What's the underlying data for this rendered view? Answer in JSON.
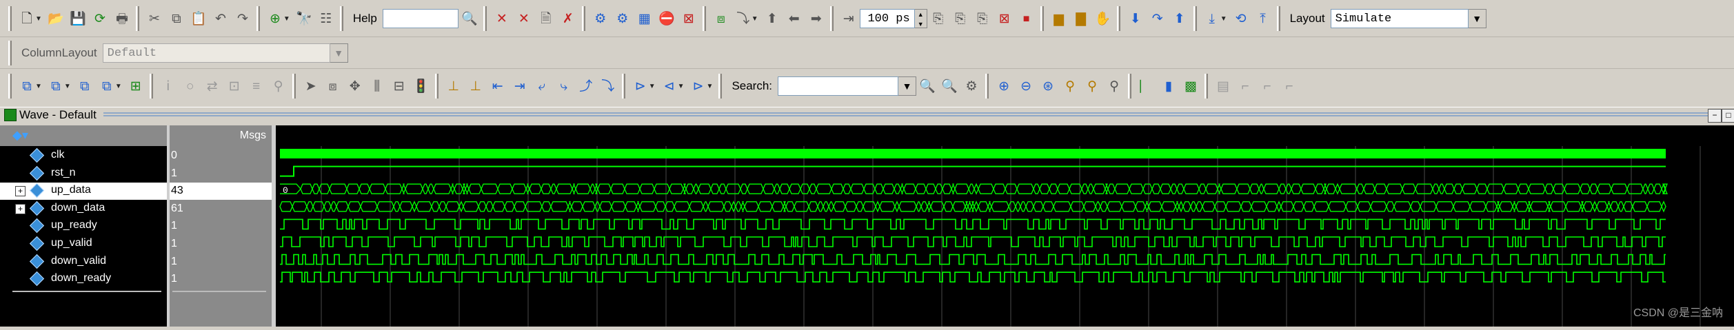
{
  "toolbar": {
    "help_label": "Help",
    "help_value": "",
    "time_value": "100",
    "time_unit": "ps",
    "layout_label": "Layout",
    "layout_value": "Simulate",
    "column_layout_label": "ColumnLayout",
    "column_layout_value": "Default",
    "search_label": "Search:",
    "search_value": ""
  },
  "wave": {
    "title": "Wave - Default",
    "msgs_header": "Msgs",
    "signals": [
      {
        "name": "clk",
        "value": "0",
        "expandable": false
      },
      {
        "name": "rst_n",
        "value": "1",
        "expandable": false
      },
      {
        "name": "up_data",
        "value": "43",
        "expandable": true,
        "selected": true
      },
      {
        "name": "down_data",
        "value": "61",
        "expandable": true
      },
      {
        "name": "up_ready",
        "value": "1",
        "expandable": false
      },
      {
        "name": "up_valid",
        "value": "1",
        "expandable": false
      },
      {
        "name": "down_valid",
        "value": "1",
        "expandable": false
      },
      {
        "name": "down_ready",
        "value": "1",
        "expandable": false
      }
    ],
    "bus_start_label": "0",
    "wave_color": "#00ff00",
    "selected_row_color": "#ffffff"
  },
  "watermark": "CSDN @是三金呐"
}
